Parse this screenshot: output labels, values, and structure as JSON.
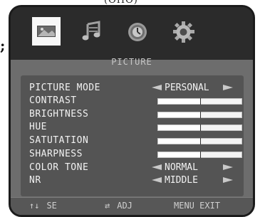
{
  "page": {
    "top_fragment": "(OHO)",
    "left_glyph": ";"
  },
  "icons": [
    {
      "name": "picture-icon",
      "active": true
    },
    {
      "name": "sound-icon",
      "active": false
    },
    {
      "name": "time-icon",
      "active": false
    },
    {
      "name": "setup-gear-icon",
      "active": false
    }
  ],
  "menu": {
    "title": "PICTURE",
    "rows": [
      {
        "label": "PICTURE MODE",
        "type": "select",
        "value": "PERSONAL"
      },
      {
        "label": "CONTRAST",
        "type": "slider",
        "level": 0.5
      },
      {
        "label": "BRIGHTNESS",
        "type": "slider",
        "level": 0.5
      },
      {
        "label": "HUE",
        "type": "slider",
        "level": 0.5
      },
      {
        "label": "SATUTATION",
        "type": "slider",
        "level": 0.5
      },
      {
        "label": "SHARPNESS",
        "type": "slider",
        "level": 0.5
      },
      {
        "label": "COLOR TONE",
        "type": "select",
        "value": "NORMAL"
      },
      {
        "label": "NR",
        "type": "select",
        "value": "MIDDLE"
      }
    ]
  },
  "footer": {
    "select_symbol": "↑↓",
    "select_label": "SE",
    "adjust_symbol": "⇄",
    "adjust_label": "ADJ",
    "exit_label": "MENU EXIT"
  }
}
